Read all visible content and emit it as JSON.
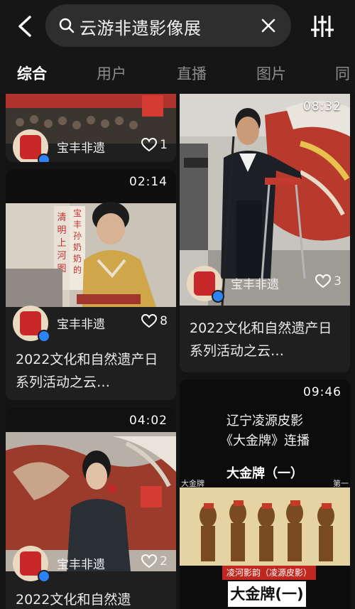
{
  "search": {
    "query": "云游非遗影像展"
  },
  "tabs": [
    "综合",
    "用户",
    "直播",
    "图片",
    "同"
  ],
  "cards": [
    {
      "author": "宝丰非遗",
      "likes": "1"
    },
    {
      "duration": "02:14",
      "author": "宝丰非遗",
      "likes": "8",
      "title": "2022文化和自然遗产日系列活动之云…",
      "thumb_text": [
        "清明上河图",
        "宝丰孙奶奶的"
      ]
    },
    {
      "duration": "04:02",
      "author": "宝丰非遗",
      "likes": "2",
      "title": "2022文化和自然遗"
    },
    {
      "duration": "08:32",
      "author": "宝丰非遗",
      "likes": "3",
      "title": "2022文化和自然遗产日系列活动之云…"
    },
    {
      "duration": "09:46",
      "thumb_text": {
        "line1": "辽宁凌源皮影",
        "line2": "《大金牌》连播",
        "line3": "大金牌（一）",
        "corner_left": "大金牌",
        "corner_right": "第一",
        "tag": "凌河影韵（凌源皮影）",
        "tag_big": "大金牌(一)"
      }
    }
  ],
  "colors": {
    "background": "#141414",
    "card": "#1f1f1f",
    "verify": "#2d83f5"
  }
}
